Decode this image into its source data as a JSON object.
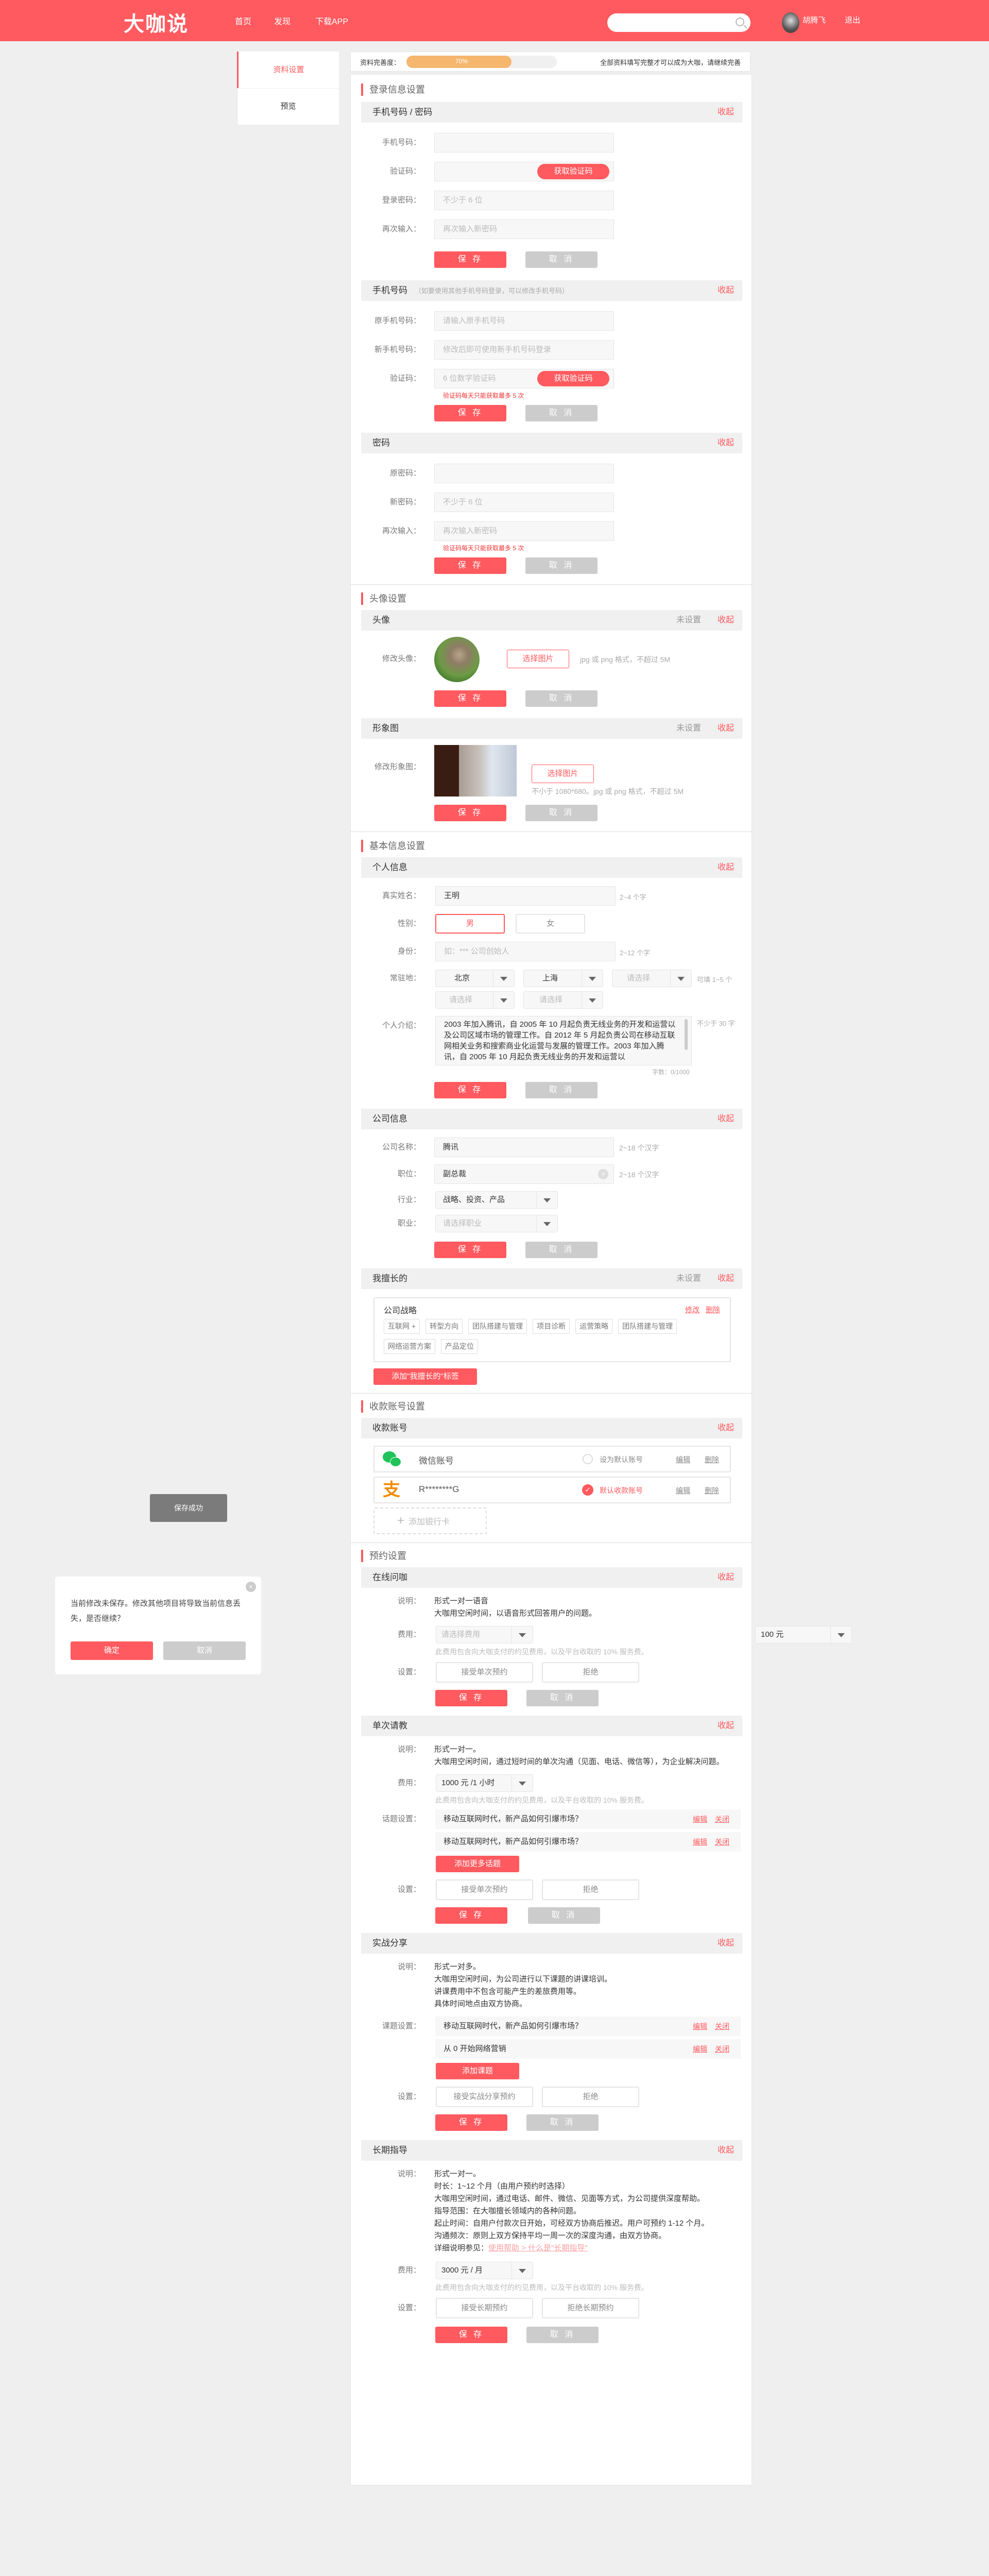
{
  "header": {
    "logo": "大咖说",
    "nav": [
      "首页",
      "发现",
      "下载APP"
    ],
    "user_name": "胡腾飞",
    "logout": "退出"
  },
  "sidebar": {
    "items": [
      "资料设置",
      "预览"
    ]
  },
  "progress": {
    "label": "资料完善度：",
    "value": 70,
    "text": "70%",
    "hint": "全部资料填写完整才可以成为大咖，请继续完善"
  },
  "colors": {
    "accent": "#ff5a5f",
    "progress": "#f5b66e",
    "cancel": "#cccccc"
  },
  "common": {
    "save": "保 存",
    "cancel": "取 消",
    "collapse": "收起",
    "not_set": "未设置",
    "get_code": "获取验证码",
    "edit": "编辑",
    "close": "关闭",
    "delete": "删除",
    "choose_image": "选择图片",
    "code_limit": "验证码每天只能获取最多 5 次",
    "fee_hint": "此费用包含向大咖支付的约见费用，以及平台收取的 10% 服务费。",
    "desc_label": "说明：",
    "fee_label": "费用：",
    "setting_label": "设置："
  },
  "login": {
    "title": "登录信息设置",
    "phone_password": {
      "title": "手机号码 / 密码",
      "fields": [
        {
          "label": "手机号码："
        },
        {
          "label": "验证码："
        },
        {
          "label": "登录密码：",
          "placeholder": "不少于 6 位"
        },
        {
          "label": "再次输入：",
          "placeholder": "再次输入新密码"
        }
      ]
    },
    "change_phone": {
      "title": "手机号码",
      "note": "（如要使用其他手机号码登录，可以修改手机号码）",
      "fields": [
        {
          "label": "原手机号码：",
          "placeholder": "请输入原手机号码"
        },
        {
          "label": "新手机号码：",
          "placeholder": "修改后即可使用新手机号码登录"
        },
        {
          "label": "验证码：",
          "placeholder": "6 位数字验证码"
        }
      ]
    },
    "password": {
      "title": "密码",
      "fields": [
        {
          "label": "原密码："
        },
        {
          "label": "新密码：",
          "placeholder": "不少于 6 位"
        },
        {
          "label": "再次输入：",
          "placeholder": "再次输入新密码"
        }
      ]
    }
  },
  "avatar": {
    "title": "头像设置",
    "avatar": {
      "title": "头像",
      "label": "修改头像：",
      "hint": "jpg 或 png 格式，不超过 5M"
    },
    "portrait": {
      "title": "形象图",
      "label": "修改形象图：",
      "hint": "不小于 1080*680。jpg 或 png 格式，不超过 5M"
    }
  },
  "basic": {
    "title": "基本信息设置",
    "personal": {
      "title": "个人信息",
      "name_label": "真实姓名：",
      "name_value": "王明",
      "name_hint": "2~4 个字",
      "gender_label": "性别：",
      "gender_options": [
        "男",
        "女"
      ],
      "identity_label": "身份：",
      "identity_placeholder": "如：*** 公司创始人",
      "identity_hint": "2~12 个字",
      "location_label": "常驻地：",
      "locations": [
        "北京",
        "上海",
        "请选择",
        "请选择",
        "请选择"
      ],
      "location_hint": "可填 1~5 个",
      "intro_label": "个人介绍：",
      "intro_value": "2003 年加入腾讯，自 2005 年 10 月起负责无线业务的开发和运营以及公司区域市场的管理工作。自 2012 年 5 月起负责公司在移动互联网相关业务和搜索商业化运营与发展的管理工作。2003 年加入腾讯，自 2005 年 10 月起负责无线业务的开发和运营以",
      "intro_hint": "不少于 30 字",
      "word_count": "字数：0/1000"
    },
    "company": {
      "title": "公司信息",
      "name_label": "公司名称：",
      "name_value": "腾讯",
      "name_hint": "2~18 个汉字",
      "position_label": "职位：",
      "position_value": "副总裁",
      "position_hint": "2~18 个汉字",
      "industry_label": "行业：",
      "industry_value": "战略、投资、产品",
      "career_label": "职业：",
      "career_placeholder": "请选择职业"
    },
    "expertise": {
      "title": "我擅长的",
      "card_title": "公司战略",
      "edit": "修改",
      "delete": "删除",
      "tags": [
        "互联网 +",
        "转型方向",
        "团队搭建与管理",
        "项目诊断",
        "运营策略",
        "团队搭建与管理",
        "网络运营方案",
        "产品定位"
      ],
      "add_button": "添加\"我擅长的\"标签"
    }
  },
  "payment": {
    "title": "收款账号设置",
    "header": "收款账号",
    "accounts": [
      {
        "name": "微信账号",
        "status": "设为默认账号"
      },
      {
        "name": "R********G",
        "status": "默认收款账号"
      }
    ],
    "add_bank": "添加银行卡"
  },
  "booking": {
    "title": "预约设置",
    "online": {
      "title": "在线问咖",
      "desc": [
        "形式一对一语音",
        "大咖用空闲时间，以语音形式回答用户的问题。"
      ],
      "fee_placeholder": "请选择费用",
      "options": [
        "接受单次预约",
        "拒绝"
      ]
    },
    "single": {
      "title": "单次请教",
      "desc": [
        "形式一对一。",
        "大咖用空闲时间，通过短时间的单次沟通（见面、电话、微信等），为企业解决问题。"
      ],
      "fee_value": "1000 元 /1 小时",
      "topic_label": "话题设置：",
      "topics": [
        "移动互联网时代，新产品如何引爆市场？",
        "移动互联网时代，新产品如何引爆市场？"
      ],
      "add_button": "添加更多话题",
      "options": [
        "接受单次预约",
        "拒绝"
      ]
    },
    "sharing": {
      "title": "实战分享",
      "desc": [
        "形式一对多。",
        "大咖用空闲时间，为公司进行以下课题的讲课培训。",
        "讲课费用中不包含可能产生的差旅费用等。",
        "具体时间地点由双方协商。"
      ],
      "topic_label": "课题设置：",
      "topics": [
        "移动互联网时代，新产品如何引爆市场？",
        "从 0 开始网络营销"
      ],
      "add_button": "添加课题",
      "options": [
        "接受实战分享预约",
        "拒绝"
      ]
    },
    "longterm": {
      "title": "长期指导",
      "desc": [
        "形式一对一。",
        "时长：1~12 个月（由用户预约时选择）",
        "大咖用空闲时间，通过电话、邮件、微信、见面等方式，为公司提供深度帮助。",
        "指导范围：在大咖擅长领域内的各种问题。",
        "起止时间：自用户付款次日开始，可经双方协商后推迟。用户可预约 1-12 个月。",
        "沟通频次：原则上双方保持平均一周一次的深度沟通，由双方协商。"
      ],
      "help_prefix": "详细说明参见：",
      "help_link": "使用帮助 > 什么是\"长期指导\"",
      "fee_value": "3000 元 / 月",
      "options": [
        "接受长期预约",
        "拒绝长期预约"
      ]
    }
  },
  "toast": "保存成功",
  "dialog": {
    "message": "当前修改未保存。修改其他项目将导致当前信息丢失，是否继续？",
    "confirm": "确定",
    "cancel": "取消"
  },
  "floating_select": "100 元"
}
